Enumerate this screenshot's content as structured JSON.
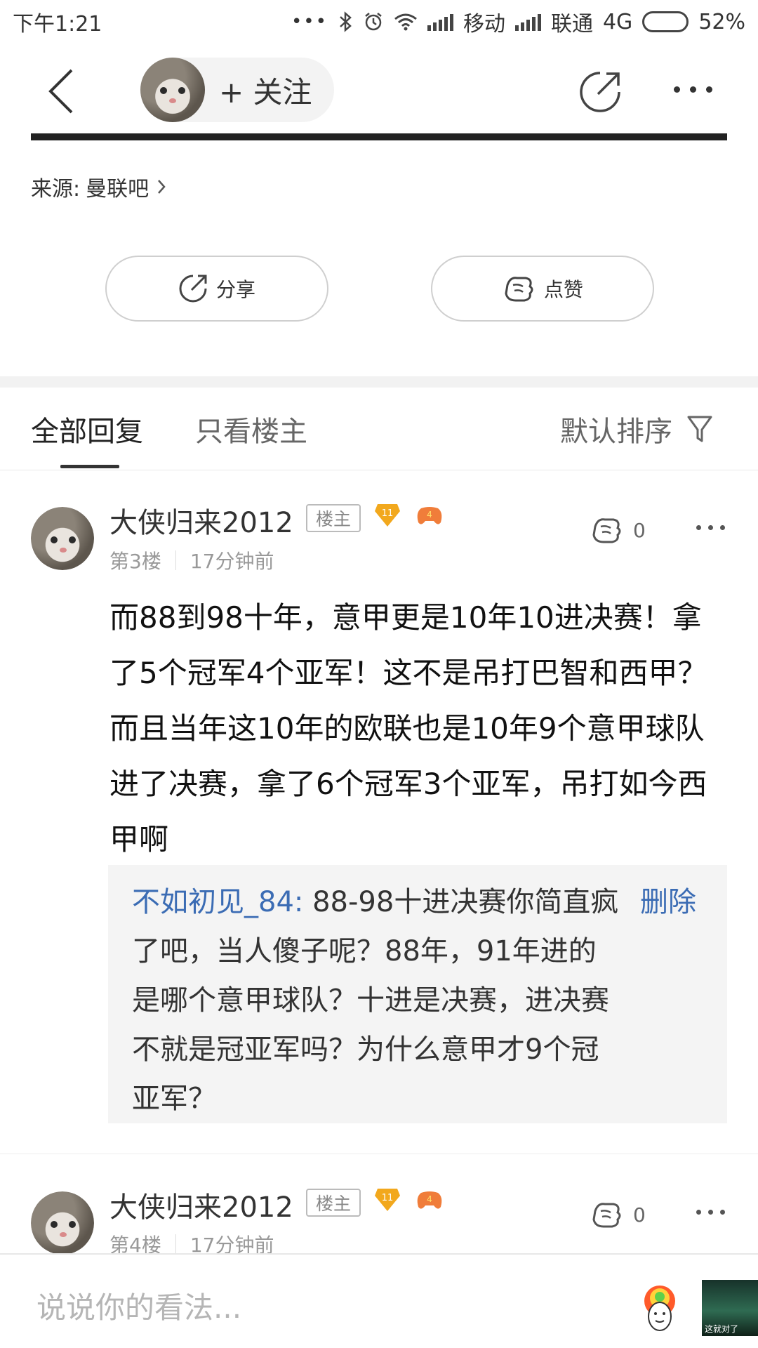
{
  "status_bar": {
    "time": "下午1:21",
    "dots": "•••",
    "carrier1": "移动",
    "carrier2": "联通",
    "network": "4G",
    "battery_level": 0.52,
    "battery_text": "52%"
  },
  "nav": {
    "follow_label": "+ 关注"
  },
  "source": {
    "prefix": "来源:",
    "forum": "曼联吧"
  },
  "actions": {
    "share": "分享",
    "like": "点赞"
  },
  "tabs": {
    "all": "全部回复",
    "op_only": "只看楼主",
    "sort": "默认排序"
  },
  "posts": [
    {
      "username": "大侠归来2012",
      "tag": "楼主",
      "level": "11",
      "game_level": "4",
      "floor": "第3楼",
      "time": "17分钟前",
      "likes": "0",
      "content": "而88到98十年，意甲更是10年10进决赛！拿了5个冠军4个亚军！这不是吊打巴智和西甲？而且当年这10年的欧联也是10年9个意甲球队进了决赛，拿了6个冠军3个亚军，吊打如今西甲啊",
      "reply": {
        "user": "不如初见_84:",
        "text": " 88-98十进决赛你简直疯了吧，当人傻子呢？88年，91年进的是哪个意甲球队？十进是决赛，进决赛不就是冠亚军吗？为什么意甲才9个冠亚军？",
        "delete": "删除"
      }
    },
    {
      "username": "大侠归来2012",
      "tag": "楼主",
      "level": "11",
      "game_level": "4",
      "floor": "第4楼",
      "time": "17分钟前",
      "likes": "0"
    }
  ],
  "bottom": {
    "placeholder": "说说你的看法...",
    "thumb_caption": "这就对了"
  },
  "colors": {
    "link_blue": "#3b6cb4",
    "badge_gold": "#f2a81d",
    "game_orange": "#f07d3a"
  }
}
